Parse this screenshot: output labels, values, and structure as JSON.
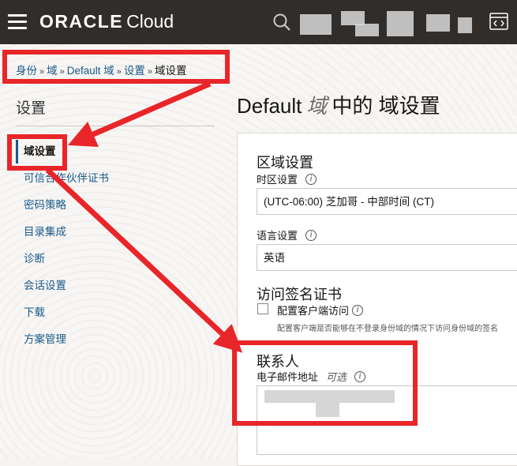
{
  "header": {
    "brand_oracle": "ORACLE",
    "brand_cloud": "Cloud",
    "icons": [
      "menu-icon",
      "search-icon",
      "code-window-icon"
    ]
  },
  "breadcrumb": {
    "items": [
      "身份",
      "域",
      "Default 域",
      "设置"
    ],
    "current": "域设置",
    "separator": "»"
  },
  "sidebar": {
    "title": "设置",
    "items": [
      {
        "label": "域设置",
        "active": true
      },
      {
        "label": "可信合作伙伴证书"
      },
      {
        "label": "密码策略"
      },
      {
        "label": "目录集成"
      },
      {
        "label": "诊断"
      },
      {
        "label": "会话设置"
      },
      {
        "label": "下载"
      },
      {
        "label": "方案管理"
      }
    ]
  },
  "main": {
    "title_prefix": "Default",
    "title_domain": "域",
    "title_suffix": "中的 域设置",
    "region_section": "区域设置",
    "timezone_label": "时区设置",
    "timezone_value": "(UTC-06:00) 芝加哥 - 中部时间 (CT)",
    "language_label": "语言设置",
    "language_value": "英语",
    "access_section": "访问签名证书",
    "client_access_label": "配置客户端访问",
    "client_access_help": "配置客户端是否能够在不登录身份域的情况下访问身份域的签名",
    "contact_section": "联系人",
    "email_label": "电子邮件地址",
    "email_optional": "可选"
  },
  "colors": {
    "topbar": "#312d2a",
    "link": "#1a5a8a",
    "annotation": "#e8262a"
  }
}
